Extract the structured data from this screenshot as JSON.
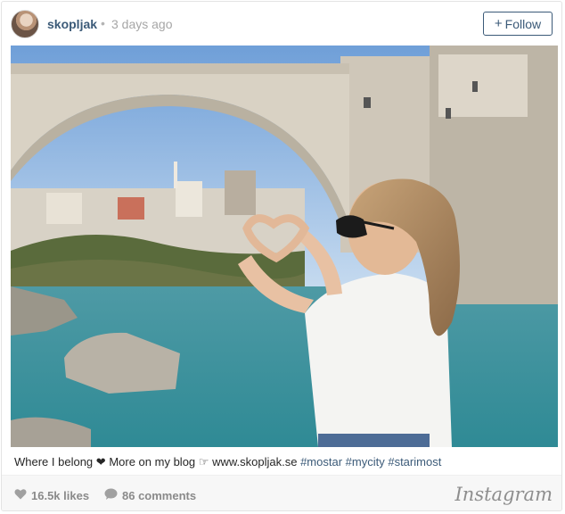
{
  "post": {
    "username": "skopljak",
    "separator": "•",
    "timestamp": "3 days ago",
    "follow_label": "Follow",
    "caption": {
      "text_start": "Where I belong",
      "heart": "❤",
      "text_mid": "More on my blog",
      "pointer": "☞",
      "link": "www.skopljak.se",
      "hashtags": [
        "#mostar",
        "#mycity",
        "#starimost"
      ]
    },
    "likes": "16.5k likes",
    "comments": "86 comments",
    "brand": "Instagram"
  },
  "colors": {
    "accent": "#3b5a78",
    "muted": "#a6a6a6",
    "footer_bg": "#f7f7f7"
  },
  "icons": [
    "plus-icon",
    "heart-icon",
    "comment-icon",
    "instagram-logo"
  ]
}
